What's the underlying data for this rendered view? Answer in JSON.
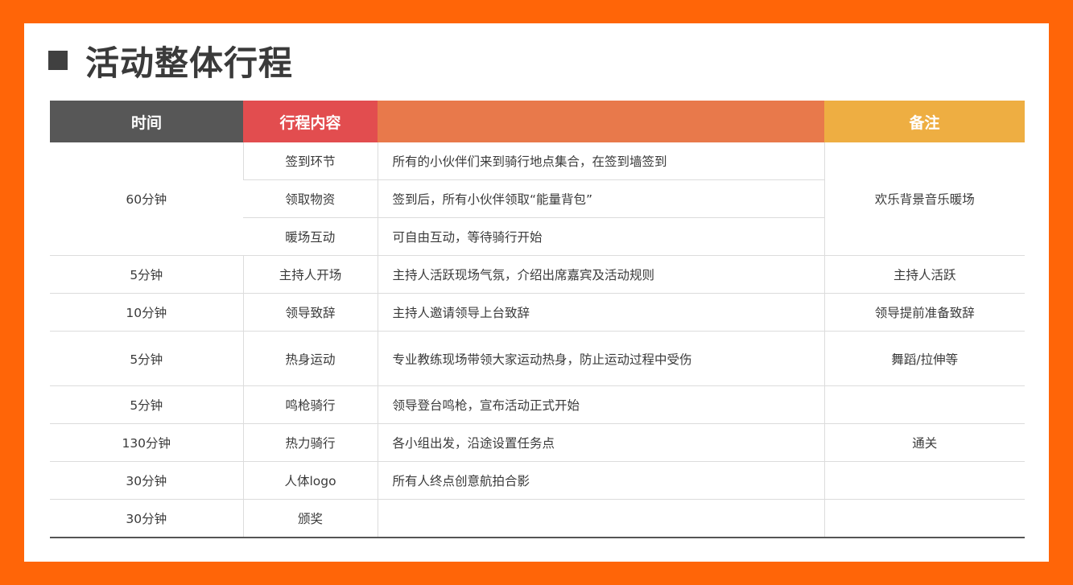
{
  "title": "活动整体行程",
  "headers": {
    "time": "时间",
    "item": "行程内容",
    "desc": "",
    "note": "备注"
  },
  "rows": [
    {
      "time": "60分钟",
      "item": "签到环节",
      "desc": "所有的小伙伴们来到骑行地点集合，在签到墙签到",
      "note": "欢乐背景音乐暖场"
    },
    {
      "item": "领取物资",
      "desc": "签到后，所有小伙伴领取“能量背包”"
    },
    {
      "item": "暖场互动",
      "desc": "可自由互动，等待骑行开始"
    },
    {
      "time": "5分钟",
      "item": "主持人开场",
      "desc": "主持人活跃现场气氛，介绍出席嘉宾及活动规则",
      "note": "主持人活跃"
    },
    {
      "time": "10分钟",
      "item": "领导致辞",
      "desc": "主持人邀请领导上台致辞",
      "note": "领导提前准备致辞"
    },
    {
      "time": "5分钟",
      "item": "热身运动",
      "desc": "专业教练现场带领大家运动热身，防止运动过程中受伤",
      "note": "舞蹈/拉伸等"
    },
    {
      "time": "5分钟",
      "item": "鸣枪骑行",
      "desc": "领导登台鸣枪，宣布活动正式开始",
      "note": ""
    },
    {
      "time": "130分钟",
      "item": "热力骑行",
      "desc": "各小组出发，沿途设置任务点",
      "note": "通关"
    },
    {
      "time": "30分钟",
      "item": "人体logo",
      "desc": "所有人终点创意航拍合影",
      "note": ""
    },
    {
      "time": "30分钟",
      "item": "颁奖",
      "desc": "",
      "note": ""
    }
  ],
  "colors": {
    "frame": "#ff6508",
    "header_time": "#575757",
    "header_item": "#e24d4f",
    "header_desc": "#e8794b",
    "header_note": "#eeae42"
  }
}
